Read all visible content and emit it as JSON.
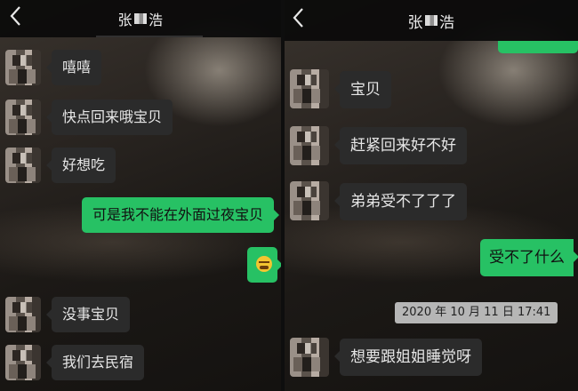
{
  "left_panel": {
    "contact_name_part1": "张",
    "contact_name_part2": "浩",
    "messages": [
      {
        "side": "in",
        "text": "嘻嘻"
      },
      {
        "side": "in",
        "text": "快点回来哦宝贝"
      },
      {
        "side": "in",
        "text": "好想吃"
      },
      {
        "side": "out",
        "text": "可是我不能在外面过夜宝贝"
      },
      {
        "side": "out",
        "emoji": "laughing-face-emoji"
      },
      {
        "side": "in",
        "text": "没事宝贝"
      },
      {
        "side": "in",
        "text": "我们去民宿"
      }
    ]
  },
  "right_panel": {
    "contact_name_part1": "张",
    "contact_name_part2": "浩",
    "messages": [
      {
        "side": "in",
        "text": "宝贝"
      },
      {
        "side": "in",
        "text": "赶紧回来好不好"
      },
      {
        "side": "in",
        "text": "弟弟受不了了了"
      },
      {
        "side": "out",
        "text": "受不了什么"
      },
      {
        "side": "in",
        "text": "想要跟姐姐睡觉呀"
      }
    ],
    "timestamp": "2020 年 10 月 11 日  17:41"
  },
  "colors": {
    "outgoing_bubble": "#27c164",
    "incoming_bubble": "#2b2b2b"
  }
}
